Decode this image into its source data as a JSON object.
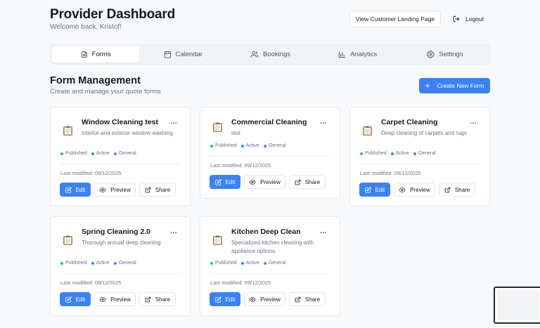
{
  "header": {
    "title": "Provider Dashboard",
    "welcome": "Welcome back, Kristof!"
  },
  "actions": {
    "landing_label": "View Customer Landing Page",
    "logout_label": "Logout"
  },
  "tabs": [
    {
      "label": "Forms",
      "icon": "file-icon",
      "active": true
    },
    {
      "label": "Calendar",
      "icon": "calendar-icon",
      "active": false
    },
    {
      "label": "Bookings",
      "icon": "users-icon",
      "active": false
    },
    {
      "label": "Analytics",
      "icon": "bar-chart-icon",
      "active": false
    },
    {
      "label": "Settings",
      "icon": "gear-icon",
      "active": false
    }
  ],
  "section": {
    "title": "Form Management",
    "subtitle": "Create and manage your quote forms",
    "create_label": "Create New Form"
  },
  "badge_colors": {
    "published": "#22c55e",
    "active": "#3b82f6",
    "general": "#a855f7"
  },
  "cards": [
    {
      "title": "Window Cleaning test",
      "description": "Interior and exterior window washing",
      "more": "...",
      "badges": [
        "Published",
        "Active",
        "General"
      ],
      "modified": "Last modified: 09/12/2025",
      "edit": "Edit",
      "preview": "Preview",
      "share": "Share"
    },
    {
      "title": "Commercial Cleaning",
      "description": "test",
      "more": "...",
      "badges": [
        "Published",
        "Active",
        "General"
      ],
      "modified": "Last modified: 09/12/2025",
      "edit": "Edit",
      "preview": "Preview",
      "share": "Share"
    },
    {
      "title": "Carpet Cleaning",
      "description": "Deep cleaning of carpets and rugs",
      "more": "...",
      "badges": [
        "Published",
        "Active",
        "General"
      ],
      "modified": "Last modified: 09/12/2025",
      "edit": "Edit",
      "preview": "Preview",
      "share": "Share"
    },
    {
      "title": "Spring Cleaning 2.0",
      "description": "Thorough annual deep cleaning",
      "more": "...",
      "badges": [
        "Published",
        "Active",
        "General"
      ],
      "modified": "Last modified: 09/12/2025",
      "edit": "Edit",
      "preview": "Preview",
      "share": "Share"
    },
    {
      "title": "Kitchen Deep Clean",
      "description": "Specialized kitchen cleaning with appliance options",
      "more": "...",
      "badges": [
        "Published",
        "Active",
        "General"
      ],
      "modified": "Last modified: 09/12/2025",
      "edit": "Edit",
      "preview": "Preview",
      "share": "Share"
    }
  ]
}
